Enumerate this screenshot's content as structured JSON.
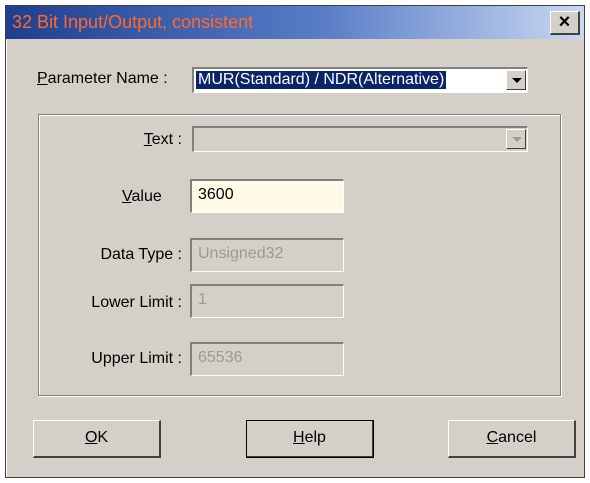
{
  "window": {
    "title": "32 Bit Input/Output, consistent",
    "close_glyph": "×"
  },
  "parameter": {
    "label_access": "P",
    "label_rest": "arameter Name :",
    "value": "MUR(Standard) / NDR(Alternative)"
  },
  "group": {
    "text": {
      "label_access": "T",
      "label_rest": "ext :",
      "value": ""
    },
    "value": {
      "label_access": "V",
      "label_rest": "alue",
      "value": "3600"
    },
    "data_type": {
      "label": "Data Type :",
      "value": "Unsigned32"
    },
    "lower_limit": {
      "label": "Lower Limit :",
      "value": "1"
    },
    "upper_limit": {
      "label": "Upper Limit :",
      "value": "65536"
    }
  },
  "buttons": {
    "ok": {
      "access": "O",
      "rest": "K"
    },
    "help": {
      "access": "H",
      "rest": "elp"
    },
    "cancel": {
      "access": "C",
      "rest": "ancel"
    }
  },
  "colors": {
    "title_text": "#ff6a2a",
    "dialog_face": "#d4d0c8",
    "edit_background": "#fff9e8",
    "selection": "#0a246a"
  }
}
